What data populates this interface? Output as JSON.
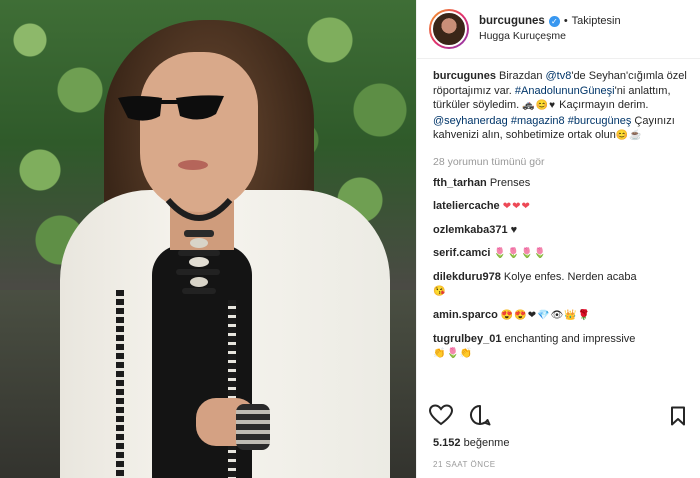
{
  "header": {
    "username": "burcugunes",
    "separator": "•",
    "follow_status": "Takiptesin",
    "location": "Hugga Kuruçeşme"
  },
  "caption": {
    "username": "burcugunes",
    "p1": "Birazdan ",
    "mention1": "@tv8",
    "p2": "'de Seyhan'cığımla özel röportajımız var. ",
    "hashtag1": "#AnadolununGüneşi",
    "p3": "'ni anlattım, türküler söyledim. ",
    "emoji1": "🚓😊♥",
    "p4": " Kaçırmayın derim. ",
    "mention2": "@seyhanerdag",
    "hashtag2": "#magazin8",
    "hashtag3": "#burcugüneş",
    "p5": " Çayınızı kahvenizi alın, sohbetimize ortak olun",
    "emoji2": "😊☕"
  },
  "view_all": "28 yorumun tümünü gör",
  "comments": [
    {
      "user": "fth_tarhan",
      "text": "Prenses"
    },
    {
      "user": "lateliercache",
      "text": "❤❤❤"
    },
    {
      "user": "ozlemkaba371",
      "text": "♥"
    },
    {
      "user": "serif.camci",
      "text": "🌷🌷🌷🌷"
    },
    {
      "user": "dilekduru978",
      "text": "Kolye enfes. Nerden acaba",
      "line2": "😘"
    },
    {
      "user": "amin.sparco",
      "text": "😍😍❤💎👁👑🌹"
    },
    {
      "user": "tugrulbey_01",
      "text": "enchanting and impressive",
      "line2": "👏🌷👏"
    }
  ],
  "likes": {
    "count": "5.152",
    "label": "beğenme"
  },
  "timestamp": "21 SAAT ÖNCE",
  "icons": {
    "like": "heart-icon",
    "comment": "comment-icon",
    "save": "bookmark-icon",
    "verified": "verified-badge-icon"
  },
  "colors": {
    "link": "#003569",
    "verified": "#3897f0",
    "muted": "#999999"
  }
}
